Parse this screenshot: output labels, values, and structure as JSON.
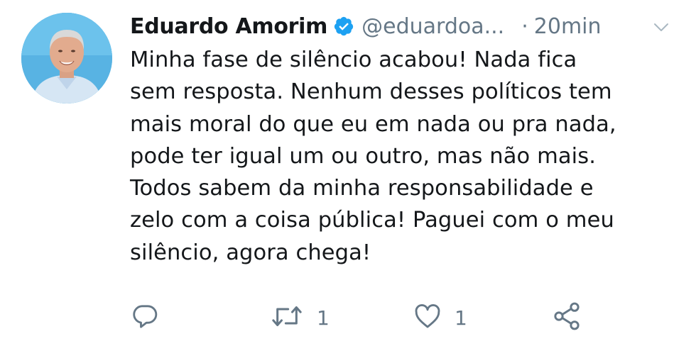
{
  "tweet": {
    "author_name": "Eduardo Amorim",
    "handle": "@eduardoa...",
    "separator": "·",
    "time": "20min",
    "text_lines": [
      "Minha fase de silêncio acabou! Nada fica",
      "sem resposta. Nenhum desses políticos tem",
      "mais moral do que eu em nada ou pra nada,",
      "pode ter igual um ou outro, mas não mais.",
      "Todos sabem da minha responsabilidade e",
      "zelo com a coisa pública! Paguei com o meu",
      "silêncio, agora chega!"
    ],
    "retweet_count": "1",
    "like_count": "1"
  },
  "icons": {
    "verified": "verified-badge-icon",
    "menu": "chevron-down-icon",
    "reply": "reply-icon",
    "retweet": "retweet-icon",
    "like": "heart-icon",
    "share": "share-icon"
  },
  "colors": {
    "text": "#14171a",
    "secondary": "#657786",
    "verified": "#1da1f2",
    "avatar_background": "#58b3e3"
  }
}
